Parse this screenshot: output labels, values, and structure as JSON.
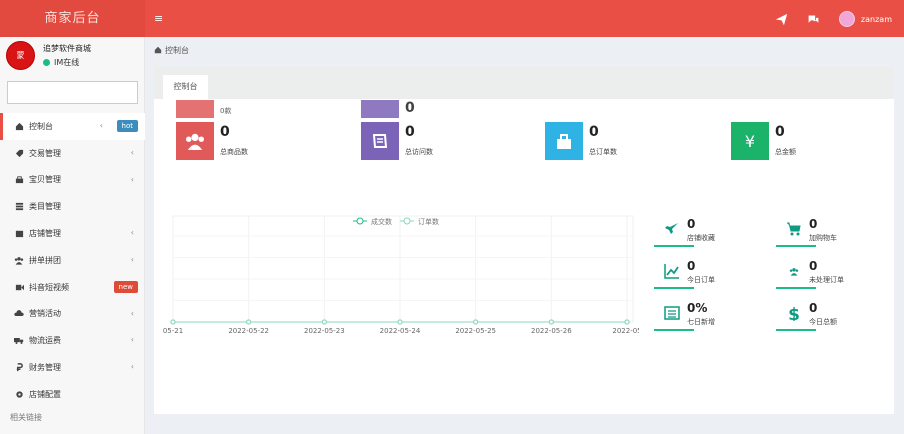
{
  "header": {
    "brand": "商家后台",
    "menu_glyph": "≡",
    "username": "zanzam"
  },
  "sidebar": {
    "shop_name": "追梦软件商城",
    "avatar_text": "蒙",
    "status": "IM在线",
    "items": [
      {
        "label": "控制台",
        "icon": "home-icon",
        "badge": "hot",
        "arrow": true
      },
      {
        "label": "交易管理",
        "icon": "tag-icon",
        "arrow": true
      },
      {
        "label": "宝贝管理",
        "icon": "bag-icon",
        "arrow": true
      },
      {
        "label": "类目管理",
        "icon": "list-icon",
        "arrow": false
      },
      {
        "label": "店铺管理",
        "icon": "store-icon",
        "arrow": true
      },
      {
        "label": "拼单拼团",
        "icon": "users-icon",
        "arrow": true
      },
      {
        "label": "抖音短视频",
        "icon": "video-icon",
        "badge": "new",
        "arrow": false
      },
      {
        "label": "营销活动",
        "icon": "cloud-icon",
        "arrow": true
      },
      {
        "label": "物流运费",
        "icon": "truck-icon",
        "arrow": true
      },
      {
        "label": "财务管理",
        "icon": "money-icon",
        "arrow": true
      },
      {
        "label": "店铺配置",
        "icon": "gear-icon",
        "arrow": false
      }
    ],
    "footer": "相关链接"
  },
  "breadcrumb": "控制台",
  "panel_tab": "控制台",
  "stats": [
    {
      "value": "0",
      "label": "总商品数",
      "color": "#e05a5a",
      "icon": "users-icon"
    },
    {
      "value": "0",
      "label": "总访问数",
      "color": "#7b63b7",
      "icon": "book-icon"
    },
    {
      "value": "0",
      "label": "总订单数",
      "color": "#2fb2e4",
      "icon": "bag-icon"
    },
    {
      "value": "0",
      "label": "总金额",
      "color": "#1bb26a",
      "icon": "yen-icon"
    }
  ],
  "ghost_stats": [
    {
      "value": "",
      "label": "0款"
    },
    {
      "value": "0",
      "label": ""
    }
  ],
  "chart_data": {
    "type": "line",
    "x": [
      "05-21",
      "2022-05-22",
      "2022-05-23",
      "2022-05-24",
      "2022-05-25",
      "2022-05-26",
      "2022-05"
    ],
    "series": [
      {
        "name": "成交数",
        "values": [
          0,
          0,
          0,
          0,
          0,
          0,
          0
        ],
        "color": "#1ebb8a"
      },
      {
        "name": "订单数",
        "values": [
          0,
          0,
          0,
          0,
          0,
          0,
          0
        ],
        "color": "#88d7be"
      }
    ],
    "legend": "top-center",
    "grid": true
  },
  "mini_stats": [
    {
      "value": "0",
      "label": "店铺收藏",
      "icon": "rocket-icon"
    },
    {
      "value": "0",
      "label": "加购物车",
      "icon": "cart-icon"
    },
    {
      "value": "0",
      "label": "今日订单",
      "icon": "chart-icon"
    },
    {
      "value": "0",
      "label": "未处理订单",
      "icon": "users-icon"
    },
    {
      "value": "0%",
      "label": "七日新增",
      "icon": "list-box-icon"
    },
    {
      "value": "0",
      "label": "今日总额",
      "icon": "dollar-icon"
    }
  ],
  "colors": {
    "primary": "#e94f44",
    "accent": "#1ebb8a"
  }
}
